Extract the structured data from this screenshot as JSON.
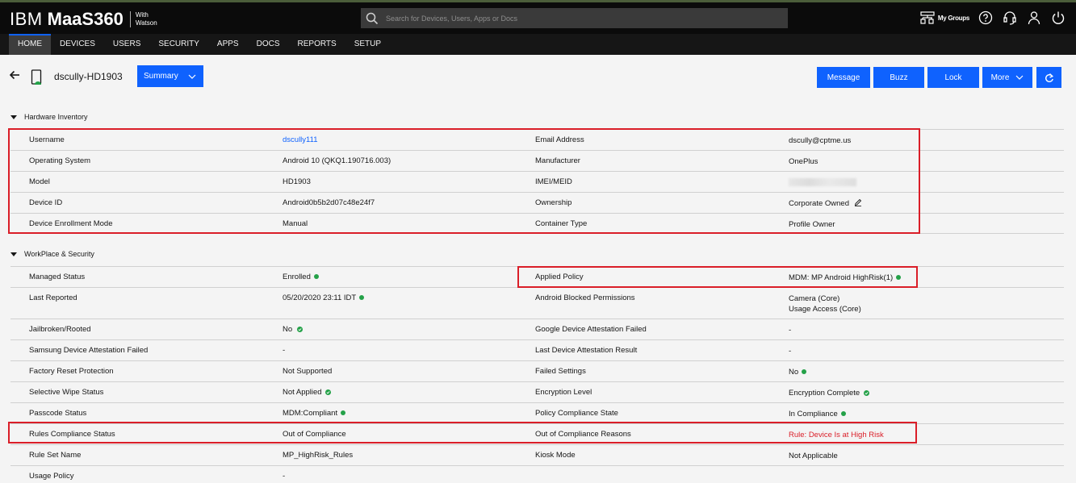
{
  "app": {
    "logo_ibm": "IBM",
    "logo_product": "MaaS360",
    "logo_with": "With",
    "logo_watson": "Watson",
    "search_placeholder": "Search for Devices, Users, Apps or Docs",
    "my_groups": "My Groups"
  },
  "nav": {
    "tabs": [
      "HOME",
      "DEVICES",
      "USERS",
      "SECURITY",
      "APPS",
      "DOCS",
      "REPORTS",
      "SETUP"
    ],
    "active": "HOME"
  },
  "header": {
    "device_name": "dscully-HD1903",
    "view_select": "Summary",
    "actions": [
      "Message",
      "Buzz",
      "Lock",
      "More"
    ]
  },
  "hardware": {
    "title": "Hardware Inventory",
    "rows": [
      {
        "l1": "Username",
        "v1": "dscully111",
        "l2": "Email Address",
        "v2": "dscully@cptme.us"
      },
      {
        "l1": "Operating System",
        "v1": "Android 10 (QKQ1.190716.003)",
        "l2": "Manufacturer",
        "v2": "OnePlus"
      },
      {
        "l1": "Model",
        "v1": "HD1903",
        "l2": "IMEI/MEID",
        "v2": ""
      },
      {
        "l1": "Device ID",
        "v1": "Android0b5b2d07c48e24f7",
        "l2": "Ownership",
        "v2": "Corporate Owned"
      },
      {
        "l1": "Device Enrollment Mode",
        "v1": "Manual",
        "l2": "Container Type",
        "v2": "Profile Owner"
      }
    ]
  },
  "workplace": {
    "title": "WorkPlace & Security",
    "rows": [
      {
        "l1": "Managed Status",
        "v1": "Enrolled",
        "l2": "Applied Policy",
        "v2": "MDM: MP Android HighRisk(1)"
      },
      {
        "l1": "Last Reported",
        "v1": "05/20/2020 23:11 IDT",
        "l2": "Android Blocked Permissions",
        "v2": "Camera (Core)",
        "v2b": "Usage Access (Core)"
      },
      {
        "l1": "Jailbroken/Rooted",
        "v1": "No",
        "l2": "Google Device Attestation Failed",
        "v2": "-"
      },
      {
        "l1": "Samsung Device Attestation Failed",
        "v1": "-",
        "l2": "Last Device Attestation Result",
        "v2": "-"
      },
      {
        "l1": "Factory Reset Protection",
        "v1": "Not Supported",
        "l2": "Failed Settings",
        "v2": "No"
      },
      {
        "l1": "Selective Wipe Status",
        "v1": "Not Applied",
        "l2": "Encryption Level",
        "v2": "Encryption Complete"
      },
      {
        "l1": "Passcode Status",
        "v1": "MDM:Compliant",
        "l2": "Policy Compliance State",
        "v2": "In Compliance"
      },
      {
        "l1": "Rules Compliance Status",
        "v1": "Out of Compliance",
        "l2": "Out of Compliance Reasons",
        "v2": "Rule: Device Is at High Risk"
      },
      {
        "l1": "Rule Set Name",
        "v1": "MP_HighRisk_Rules",
        "l2": "Kiosk Mode",
        "v2": "Not Applicable"
      },
      {
        "l1": "Usage Policy",
        "v1": "-",
        "l2": "",
        "v2": ""
      }
    ]
  },
  "colors": {
    "accent": "#0f62fe",
    "highlight": "#da1e28",
    "status_ok": "#24a148"
  }
}
